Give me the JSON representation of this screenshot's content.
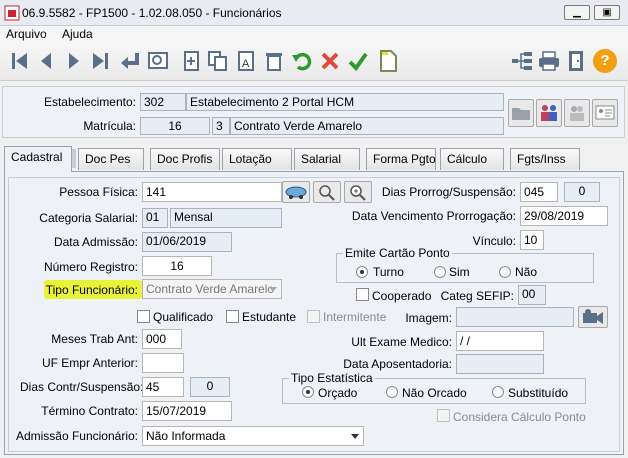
{
  "window": {
    "title": "06.9.5582 - FP1500 - 1.02.08.050 - Funcionários"
  },
  "menu": [
    "Arquivo",
    "Ajuda"
  ],
  "toolbar": {
    "icons": [
      "first-icon",
      "prev-icon",
      "next-icon",
      "last-icon",
      "enter-icon",
      "preview-icon",
      "new-icon",
      "copy-icon",
      "text-icon",
      "delete-icon",
      "undo-icon",
      "cancel-icon",
      "confirm-icon",
      "blank-doc-icon",
      "tree-icon",
      "print-icon",
      "exit-icon",
      "help-icon"
    ],
    "help_label": "?"
  },
  "header": {
    "estabelecimento_label": "Estabelecimento:",
    "estabelecimento_code": "302",
    "estabelecimento_name": "Estabelecimento 2 Portal HCM",
    "matricula_label": "Matrícula:",
    "matricula_value": "16",
    "contrato_code": "3",
    "contrato_name": "Contrato Verde Amarelo"
  },
  "tabs": [
    "Cadastral",
    "Doc Pes",
    "Doc Profis",
    "Lotação",
    "Salarial",
    "Forma Pgto",
    "Cálculo",
    "Fgts/Inss"
  ],
  "form": {
    "pessoa_fisica_label": "Pessoa Física:",
    "pessoa_fisica_value": "141",
    "categoria_label": "Categoria Salarial:",
    "categoria_code": "01",
    "categoria_name": "Mensal",
    "data_admissao_label": "Data Admissão:",
    "data_admissao_value": "01/06/2019",
    "numero_registro_label": "Número Registro:",
    "numero_registro_value": "16",
    "tipo_funcionario_label": "Tipo Funcionário:",
    "tipo_funcionario_value": "Contrato Verde Amarelo",
    "qualificado_label": "Qualificado",
    "estudante_label": "Estudante",
    "intermitente_label": "Intermitente",
    "meses_trab_label": "Meses Trab Ant:",
    "meses_trab_value": "000",
    "uf_empr_label": "UF Empr Anterior:",
    "uf_empr_value": "",
    "dias_contr_label": "Dias Contr/Suspensão:",
    "dias_contr_value": "45",
    "dias_contr_extra": "0",
    "termino_label": "Término Contrato:",
    "termino_value": "15/07/2019",
    "admissao_func_label": "Admissão Funcionário:",
    "admissao_func_value": "Não Informada",
    "dias_prorrog_label": "Dias Prorrog/Suspensão:",
    "dias_prorrog_value": "045",
    "dias_prorrog_extra": "0",
    "data_venc_label": "Data Vencimento Prorrogação:",
    "data_venc_value": "29/08/2019",
    "vinculo_label": "Vínculo:",
    "vinculo_value": "10",
    "emite_cartao_caption": "Emite Cartão Ponto",
    "emite_turno": "Turno",
    "emite_sim": "Sim",
    "emite_nao": "Não",
    "cooperado_label": "Cooperado",
    "categ_sefip_label": "Categ SEFIP:",
    "categ_sefip_value": "00",
    "imagem_label": "Imagem:",
    "ult_exame_label": "Ult Exame Medico:",
    "ult_exame_value": "/ /",
    "data_apos_label": "Data Aposentadoria:",
    "tipo_estat_caption": "Tipo Estatística",
    "tipo_orcado": "Orçado",
    "tipo_nao_orcado": "Não Orcado",
    "tipo_substituido": "Substituído",
    "considera_label": "Considera Cálculo Ponto"
  },
  "colors": {
    "highlight": "#e8f23a",
    "panel": "#eef2f7",
    "readonly": "#e6edf4"
  }
}
